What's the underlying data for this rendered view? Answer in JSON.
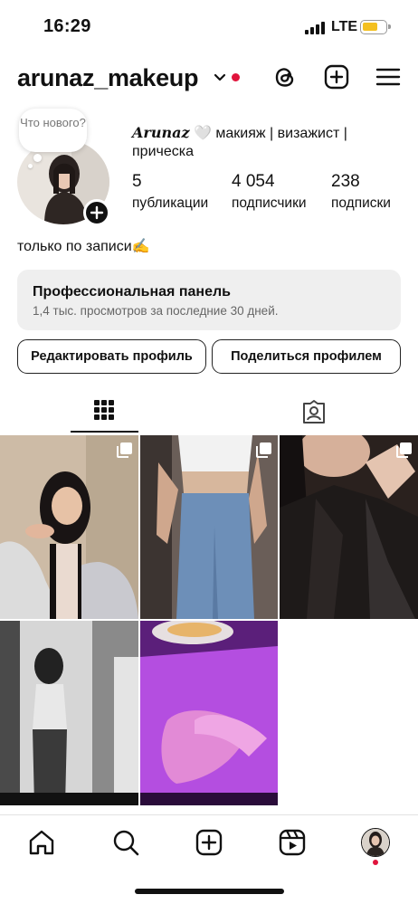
{
  "status_bar": {
    "time": "16:29",
    "network": "LTE",
    "battery_color": "#f4c020"
  },
  "header": {
    "username": "arunaz_makeup",
    "icons": [
      "chevron-down-icon",
      "threads-icon",
      "create-icon",
      "menu-icon"
    ],
    "notification_color": "#e0143c"
  },
  "profile": {
    "note_bubble": "Что нового?",
    "display_name": "Arunaz",
    "display_name_emoji": "🤍",
    "category": "макияж | визажист | прическа",
    "stats": [
      {
        "value": "5",
        "label": "публикации"
      },
      {
        "value": "4 054",
        "label": "подписчики"
      },
      {
        "value": "238",
        "label": "подписки"
      }
    ],
    "bio": "только по записи✍️"
  },
  "pro_panel": {
    "title": "Профессиональная панель",
    "subtitle": "1,4 тыс. просмотров за последние 30 дней."
  },
  "buttons": {
    "edit": "Редактировать профиль",
    "share": "Поделиться профилем"
  },
  "tabs": [
    {
      "icon": "grid-icon",
      "active": true
    },
    {
      "icon": "tagged-icon",
      "active": false
    }
  ],
  "posts": [
    {
      "subject": "girl-selfie-pink-cardigan",
      "multi": true
    },
    {
      "subject": "jeans-crop-top",
      "multi": true
    },
    {
      "subject": "black-leather-jacket",
      "multi": true
    },
    {
      "subject": "mirror-selfie-bw",
      "multi": false
    },
    {
      "subject": "hands-purple-light",
      "multi": false
    }
  ],
  "bottom_nav": [
    "home-icon",
    "search-icon",
    "create-icon",
    "reels-icon",
    "profile-avatar"
  ]
}
